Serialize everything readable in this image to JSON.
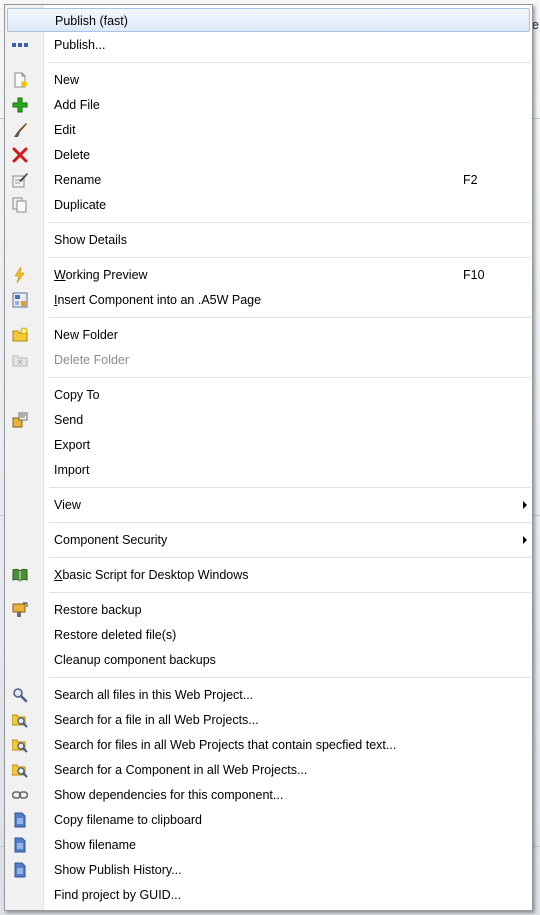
{
  "background": {
    "edge_char": "e"
  },
  "menu": {
    "items": [
      {
        "label": "Publish (fast)",
        "icon": "none",
        "highlighted": true
      },
      {
        "label": "Publish...",
        "icon": "publish-dots-icon"
      },
      {
        "label": "New",
        "icon": "new-document-icon"
      },
      {
        "label": "Add File",
        "icon": "add-plus-icon"
      },
      {
        "label": "Edit",
        "icon": "edit-brush-icon"
      },
      {
        "label": "Delete",
        "icon": "delete-x-icon"
      },
      {
        "label": "Rename",
        "icon": "rename-icon",
        "shortcut": "F2"
      },
      {
        "label": "Duplicate",
        "icon": "duplicate-icon"
      },
      {
        "label": "Show Details",
        "icon": "none"
      },
      {
        "label_mn": "W",
        "label_rest": "orking Preview",
        "icon": "lightning-icon",
        "shortcut": "F10"
      },
      {
        "label_mn": "I",
        "label_rest": "nsert Component into an .A5W Page",
        "icon": "insert-component-icon"
      },
      {
        "label": "New Folder",
        "icon": "new-folder-icon"
      },
      {
        "label": "Delete Folder",
        "icon": "delete-folder-icon",
        "disabled": true
      },
      {
        "label": "Copy To",
        "icon": "none"
      },
      {
        "label": "Send",
        "icon": "send-icon"
      },
      {
        "label": "Export",
        "icon": "none"
      },
      {
        "label": "Import",
        "icon": "none"
      },
      {
        "label": "View",
        "icon": "none",
        "submenu": true
      },
      {
        "label": "Component Security",
        "icon": "none",
        "submenu": true
      },
      {
        "label_mn": "X",
        "label_rest": "basic Script for Desktop Windows",
        "icon": "book-icon"
      },
      {
        "label": "Restore backup",
        "icon": "restore-icon"
      },
      {
        "label": "Restore deleted file(s)",
        "icon": "none"
      },
      {
        "label": "Cleanup component backups",
        "icon": "none"
      },
      {
        "label": "Search all files in this Web Project...",
        "icon": "magnifier-icon"
      },
      {
        "label": "Search for a file in all Web Projects...",
        "icon": "folder-search-icon"
      },
      {
        "label": "Search for files in all Web Projects that contain specfied text...",
        "icon": "folder-search-icon"
      },
      {
        "label": "Search for a Component in all Web Projects...",
        "icon": "folder-search-icon"
      },
      {
        "label": "Show dependencies for this component...",
        "icon": "chain-link-icon"
      },
      {
        "label": "Copy filename to clipboard",
        "icon": "document-blue-icon"
      },
      {
        "label": "Show filename",
        "icon": "document-blue-icon"
      },
      {
        "label": "Show Publish History...",
        "icon": "document-blue-icon"
      },
      {
        "label": "Find project by GUID...",
        "icon": "none"
      }
    ]
  },
  "colors": {
    "highlight_border": "#a9c1e6",
    "disabled_text": "#8d8d8d",
    "gutter": "#f1f1f1"
  }
}
